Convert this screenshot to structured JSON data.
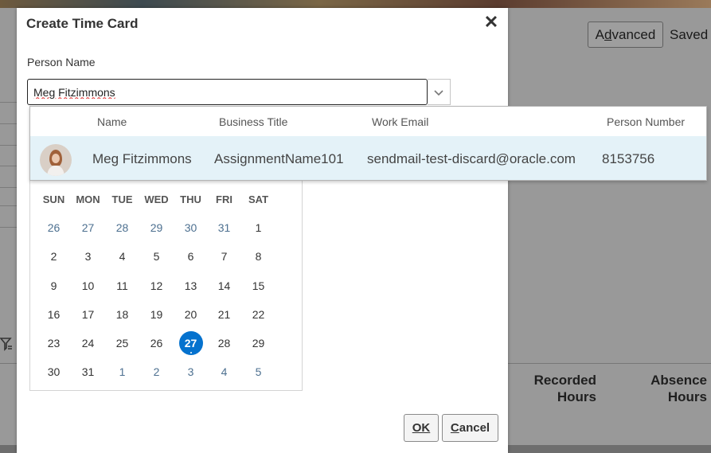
{
  "background": {
    "advanced_prefix": "A",
    "advanced_underline": "d",
    "advanced_suffix": "vanced",
    "saved_label": "Saved",
    "columns": [
      {
        "line1": "Recorded",
        "line2": "Hours"
      },
      {
        "line1": "Absence",
        "line2": "Hours"
      }
    ]
  },
  "dialog": {
    "title": "Create Time Card",
    "close_glyph": "✕",
    "person_label": "Person Name",
    "person_value": "Meg Fitzimmons",
    "dropdown_glyph": "⌄",
    "ok_label": "OK",
    "cancel_underline": "C",
    "cancel_suffix": "ancel"
  },
  "popup": {
    "headers": [
      "Name",
      "Business Title",
      "Work Email",
      "Person Number"
    ],
    "rows": [
      {
        "avatar": "person-photo",
        "name": "Meg Fitzimmons",
        "title": "AssignmentName101",
        "email": "sendmail-test-discard@oracle.com",
        "number": "8153756"
      }
    ]
  },
  "calendar": {
    "days_of_week": [
      "SUN",
      "MON",
      "TUE",
      "WED",
      "THU",
      "FRI",
      "SAT"
    ],
    "weeks": [
      [
        "26",
        "27",
        "28",
        "29",
        "30",
        "31",
        "1"
      ],
      [
        "2",
        "3",
        "4",
        "5",
        "6",
        "7",
        "8"
      ],
      [
        "9",
        "10",
        "11",
        "12",
        "13",
        "14",
        "15"
      ],
      [
        "16",
        "17",
        "18",
        "19",
        "20",
        "21",
        "22"
      ],
      [
        "23",
        "24",
        "25",
        "26",
        "27",
        "28",
        "29"
      ],
      [
        "30",
        "31",
        "1",
        "2",
        "3",
        "4",
        "5"
      ]
    ],
    "selected": "27",
    "accent": "#0572ce"
  }
}
